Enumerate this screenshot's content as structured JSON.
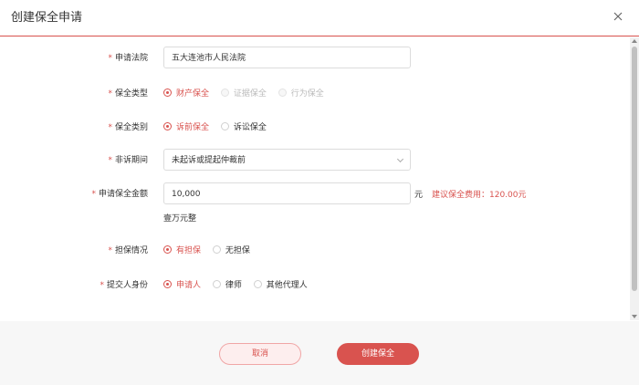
{
  "dialog": {
    "title": "创建保全申请"
  },
  "form": {
    "court": {
      "label": "申请法院",
      "value": "五大连池市人民法院"
    },
    "preservation_type": {
      "label": "保全类型",
      "options": [
        "财产保全",
        "证据保全",
        "行为保全"
      ],
      "selected": "财产保全",
      "disabled": [
        "证据保全",
        "行为保全"
      ]
    },
    "preservation_category": {
      "label": "保全类别",
      "options": [
        "诉前保全",
        "诉讼保全"
      ],
      "selected": "诉前保全"
    },
    "non_litigation_period": {
      "label": "非诉期间",
      "value": "未起诉或提起仲裁前"
    },
    "amount": {
      "label": "申请保全金额",
      "value": "10,000",
      "unit": "元",
      "fee_hint": "建议保全费用：120.00元",
      "in_words": "壹万元整"
    },
    "guarantee": {
      "label": "担保情况",
      "options": [
        "有担保",
        "无担保"
      ],
      "selected": "有担保"
    },
    "submitter_identity": {
      "label": "提交人身份",
      "options": [
        "申请人",
        "律师",
        "其他代理人"
      ],
      "selected": "申请人"
    }
  },
  "buttons": {
    "cancel": "取消",
    "create": "创建保全"
  },
  "colors": {
    "accent": "#d9534f"
  }
}
